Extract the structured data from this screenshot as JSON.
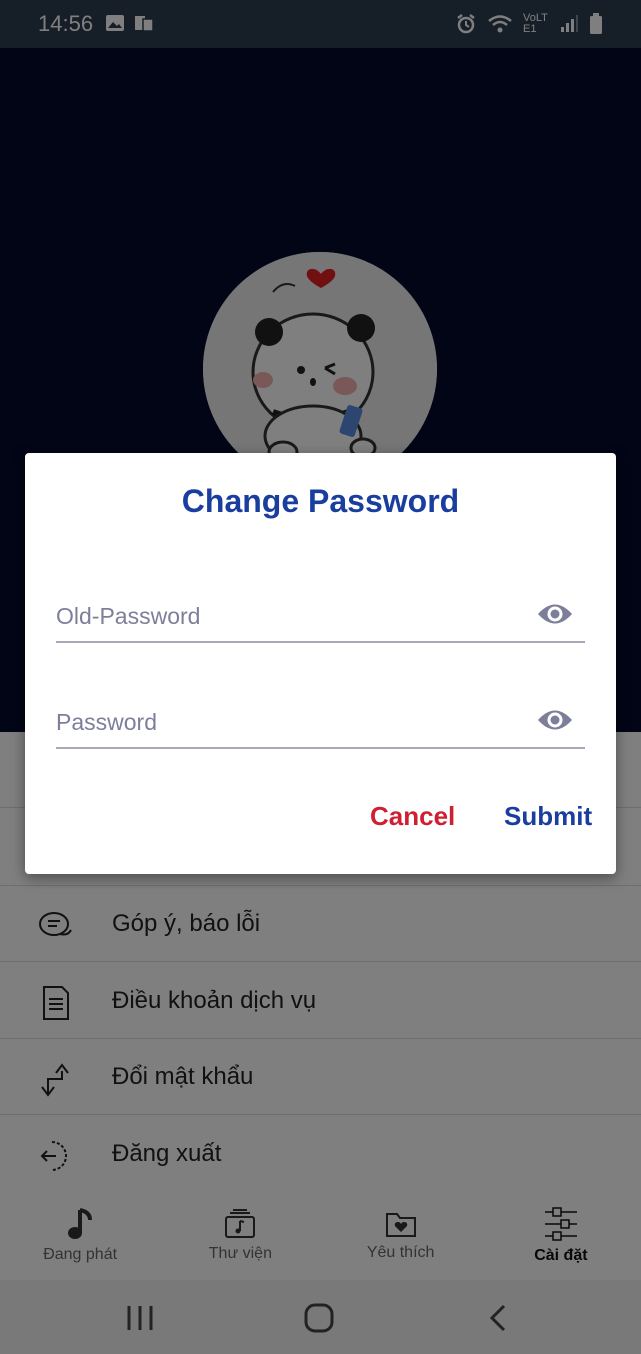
{
  "status_bar": {
    "time": "14:56",
    "lte_label": "VoLTE1"
  },
  "settings": {
    "items": [
      {
        "label": "Góp ý, báo lỗi",
        "icon": "feedback-chat-icon"
      },
      {
        "label": "Điều khoản dịch vụ",
        "icon": "document-icon"
      },
      {
        "label": "Đổi mật khẩu",
        "icon": "swap-arrows-icon"
      },
      {
        "label": "Đăng xuất",
        "icon": "logout-icon"
      }
    ]
  },
  "bottom_nav": {
    "items": [
      {
        "label": "Đang phát",
        "icon": "music-note-icon"
      },
      {
        "label": "Thư viện",
        "icon": "library-icon"
      },
      {
        "label": "Yêu thích",
        "icon": "heart-folder-icon"
      },
      {
        "label": "Cài đặt",
        "icon": "sliders-icon",
        "active": true
      }
    ]
  },
  "dialog": {
    "title": "Change Password",
    "old_password_placeholder": "Old-Password",
    "password_placeholder": "Password",
    "cancel_label": "Cancel",
    "submit_label": "Submit"
  },
  "colors": {
    "header_bg": "#050a2a",
    "title": "#1a3e9e",
    "cancel": "#cf1f33",
    "submit": "#1a3e9e",
    "eye": "#7d7f9a"
  }
}
